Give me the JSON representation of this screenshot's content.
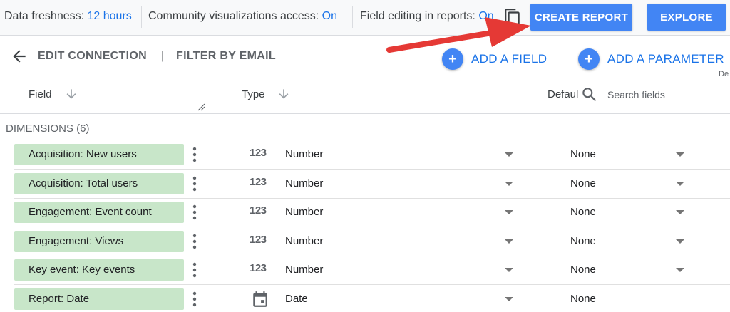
{
  "topbar": {
    "freshness_label": "Data freshness:",
    "freshness_value": "12 hours",
    "community_label": "Community visualizations access:",
    "community_value": "On",
    "editing_label": "Field editing in reports:",
    "editing_value": "On",
    "create_report": "CREATE REPORT",
    "explore": "EXPLORE"
  },
  "toolbar": {
    "edit_connection": "EDIT CONNECTION",
    "separator": "|",
    "filter_by_email": "FILTER BY EMAIL",
    "add_field": "ADD A FIELD",
    "add_parameter": "ADD A PARAMETER",
    "plus": "+"
  },
  "columns": {
    "field": "Field",
    "type": "Type",
    "default": "Defaul",
    "overflow": "De"
  },
  "search": {
    "placeholder": "Search fields"
  },
  "section": {
    "label": "DIMENSIONS (6)"
  },
  "rows": [
    {
      "name": "Acquisition: New users",
      "type_icon": "123",
      "type": "Number",
      "default": "None"
    },
    {
      "name": "Acquisition: Total users",
      "type_icon": "123",
      "type": "Number",
      "default": "None"
    },
    {
      "name": "Engagement: Event count",
      "type_icon": "123",
      "type": "Number",
      "default": "None"
    },
    {
      "name": "Engagement: Views",
      "type_icon": "123",
      "type": "Number",
      "default": "None"
    },
    {
      "name": "Key event: Key events",
      "type_icon": "123",
      "type": "Number",
      "default": "None"
    },
    {
      "name": "Report: Date",
      "type_icon": "calendar-icon",
      "type": "Date",
      "default": "None"
    }
  ],
  "colors": {
    "accent": "#4285f4",
    "link": "#1a73e8",
    "chip": "#c8e6c9",
    "arrow": "#e53935"
  }
}
